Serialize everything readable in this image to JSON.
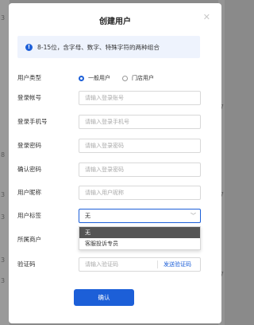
{
  "background": {
    "left_marks": [
      "3",
      "3",
      "3",
      "8",
      "3",
      "3",
      "3",
      "3",
      "3",
      "3",
      "3"
    ],
    "right_marks": [
      "7",
      "3",
      "3",
      "7",
      "3",
      "3",
      "3",
      "7"
    ]
  },
  "modal": {
    "title": "创建用户",
    "close_icon": "close-icon",
    "notice": {
      "icon": "info-icon",
      "icon_glyph": "!",
      "text": "8-15位，含字母、数字、特殊字符的两种组合"
    },
    "form": {
      "user_type": {
        "label": "用户类型",
        "options": [
          {
            "label": "一般用户",
            "checked": true
          },
          {
            "label": "门店用户",
            "checked": false
          }
        ]
      },
      "login_account": {
        "label": "登录帐号",
        "placeholder": "请输入登录账号"
      },
      "login_phone": {
        "label": "登录手机号",
        "placeholder": "请输入登录手机号"
      },
      "login_password": {
        "label": "登录密码",
        "placeholder": "请输入登录密码"
      },
      "confirm_password": {
        "label": "确认密码",
        "placeholder": "请输入登录密码"
      },
      "nickname": {
        "label": "用户昵称",
        "placeholder": "请输入用户昵称"
      },
      "user_tag": {
        "label": "用户标签",
        "value": "无",
        "options": [
          "无",
          "客服投诉专员"
        ]
      },
      "store": {
        "label": "所属商户"
      },
      "verification_code": {
        "label": "验证码",
        "placeholder": "请输入验证码",
        "send_label": "发送验证码"
      }
    },
    "confirm_label": "确认"
  },
  "colors": {
    "accent": "#1c5fd8",
    "overlay": "#8a8a8a",
    "notice_bg": "#eef3fd"
  }
}
